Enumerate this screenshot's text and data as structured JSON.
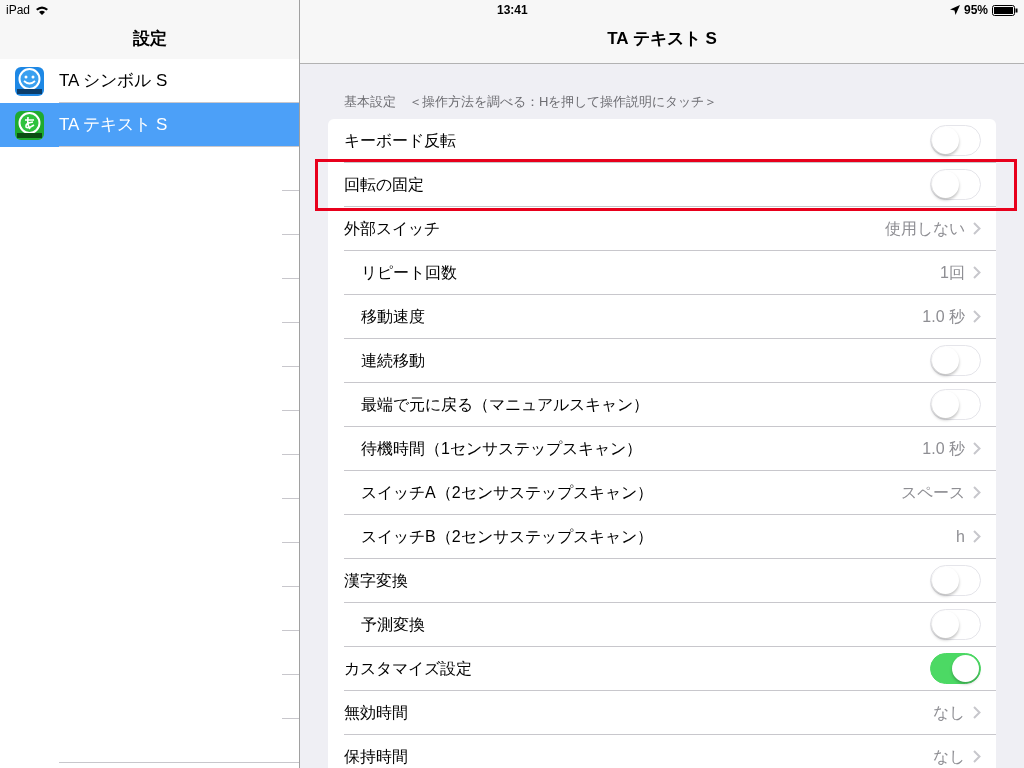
{
  "status_bar": {
    "device": "iPad",
    "time": "13:41",
    "battery": "95%"
  },
  "sidebar": {
    "title": "設定",
    "items": [
      {
        "label": "TA シンボル S",
        "selected": false
      },
      {
        "label": "TA テキスト S",
        "selected": true
      }
    ]
  },
  "detail": {
    "title": "TA テキスト S",
    "section_header": "基本設定　＜操作方法を調べる：Hを押して操作説明にタッチ＞",
    "rows": [
      {
        "kind": "toggle",
        "label": "キーボード反転",
        "on": false,
        "highlighted": false
      },
      {
        "kind": "toggle",
        "label": "回転の固定",
        "on": false,
        "highlighted": true
      },
      {
        "kind": "value",
        "label": "外部スイッチ",
        "value": "使用しない",
        "highlighted": false,
        "children": [
          {
            "kind": "value",
            "label": "リピート回数",
            "value": "1回",
            "highlighted": false
          },
          {
            "kind": "value",
            "label": "移動速度",
            "value": "1.0 秒",
            "highlighted": false
          },
          {
            "kind": "toggle",
            "label": "連続移動",
            "on": false,
            "highlighted": false
          },
          {
            "kind": "toggle",
            "label": "最端で元に戻る（マニュアルスキャン）",
            "on": false,
            "highlighted": false
          },
          {
            "kind": "value",
            "label": "待機時間（1センサステップスキャン）",
            "value": "1.0 秒",
            "highlighted": false
          },
          {
            "kind": "value",
            "label": "スイッチA（2センサステップスキャン）",
            "value": "スペース",
            "highlighted": false
          },
          {
            "kind": "value",
            "label": "スイッチB（2センサステップスキャン）",
            "value": "h",
            "highlighted": false
          }
        ]
      },
      {
        "kind": "toggle",
        "label": "漢字変換",
        "on": false,
        "highlighted": false,
        "children": [
          {
            "kind": "toggle",
            "label": "予測変換",
            "on": false,
            "highlighted": false
          }
        ]
      },
      {
        "kind": "toggle",
        "label": "カスタマイズ設定",
        "on": true,
        "highlighted": false
      },
      {
        "kind": "value",
        "label": "無効時間",
        "value": "なし",
        "highlighted": false
      },
      {
        "kind": "value",
        "label": "保持時間",
        "value": "なし",
        "highlighted": false
      }
    ]
  }
}
